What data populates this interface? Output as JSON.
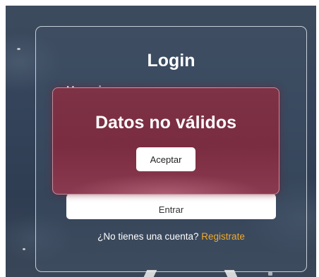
{
  "login": {
    "title": "Login",
    "username_label": "Usuario:",
    "submit_label": "Entrar",
    "signup_prompt": "¿No tienes una cuenta?",
    "signup_link": "Registrate"
  },
  "modal": {
    "title": "Datos no válidos",
    "confirm_label": "Aceptar"
  },
  "colors": {
    "accent_link": "#f0a92c",
    "modal_background": "#7a2c40",
    "page_background": "#34435a"
  }
}
